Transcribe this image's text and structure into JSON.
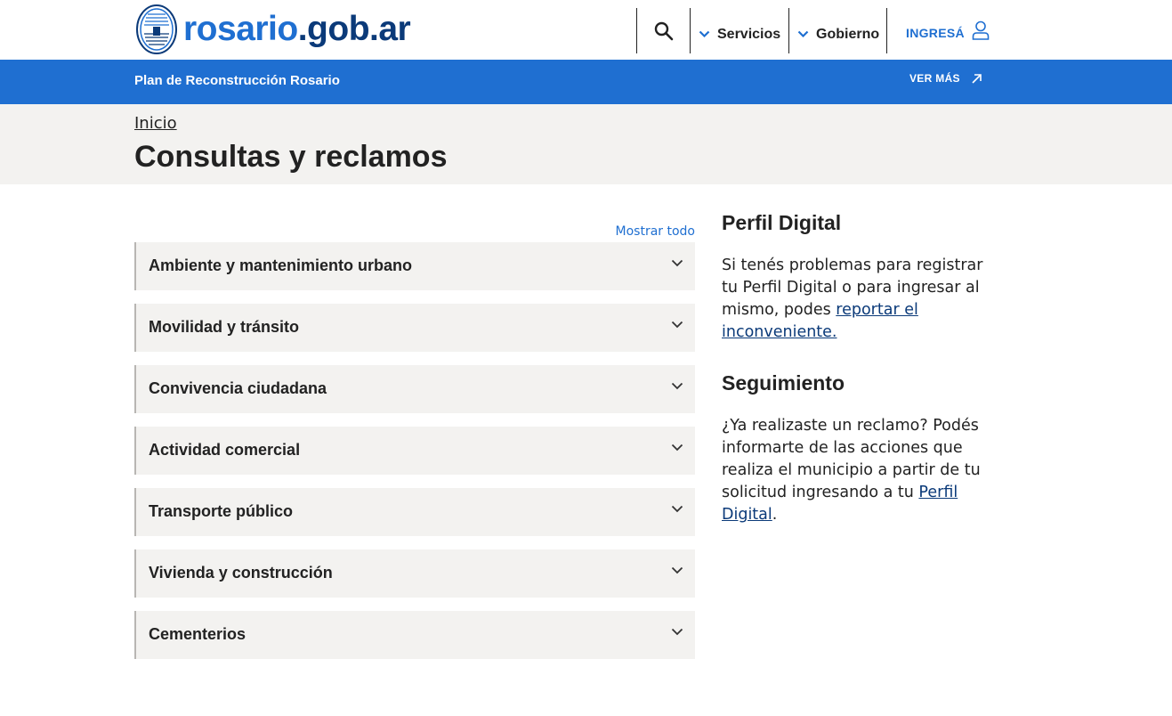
{
  "header": {
    "logo_main": "rosario",
    "logo_domain": ".gob.ar",
    "nav": [
      {
        "label": "Servicios"
      },
      {
        "label": "Gobierno"
      }
    ],
    "login_label": "INGRESÁ"
  },
  "banner": {
    "title": "Plan de Reconstrucción Rosario",
    "more_label": "VER MÁS"
  },
  "page": {
    "breadcrumb": "Inicio",
    "title": "Consultas y reclamos"
  },
  "accordion": {
    "show_all_label": "Mostrar todo",
    "items": [
      {
        "label": "Ambiente y mantenimiento urbano"
      },
      {
        "label": "Movilidad y tránsito"
      },
      {
        "label": "Convivencia ciudadana"
      },
      {
        "label": "Actividad comercial"
      },
      {
        "label": "Transporte público"
      },
      {
        "label": "Vivienda y construcción"
      },
      {
        "label": "Cementerios"
      }
    ]
  },
  "sidebar": {
    "perfil": {
      "heading": "Perfil Digital",
      "text": "Si tenés problemas para registrar tu Perfil Digital o para ingresar al mismo, podes ",
      "link": "reportar el inconveniente."
    },
    "seguimiento": {
      "heading": "Seguimiento",
      "text": "¿Ya realizaste un reclamo? Podés informarte de las acciones que realiza el municipio a partir de tu solicitud ingresando a tu ",
      "link": "Perfil Digital",
      "suffix": "."
    }
  },
  "colors": {
    "brand_blue": "#1f6fd1",
    "dark_blue": "#0b3a79",
    "band_grey": "#f3f2f0"
  },
  "icons": [
    "search-icon",
    "chevron-down-icon",
    "user-icon",
    "arrow-up-right-icon",
    "city-seal-icon"
  ]
}
